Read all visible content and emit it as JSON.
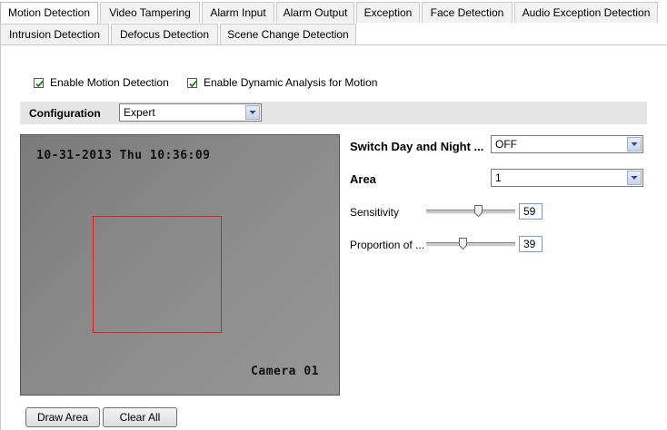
{
  "tabs_row1": [
    "Motion Detection",
    "Video Tampering",
    "Alarm Input",
    "Alarm Output",
    "Exception",
    "Face Detection",
    "Audio Exception Detection"
  ],
  "tabs_row2": [
    "Intrusion Detection",
    "Defocus Detection",
    "Scene Change Detection"
  ],
  "active_tab": "Motion Detection",
  "checkboxes": {
    "enable_motion": {
      "label": "Enable Motion Detection",
      "checked": true
    },
    "enable_dynamic": {
      "label": "Enable Dynamic Analysis for Motion",
      "checked": true
    }
  },
  "config": {
    "label": "Configuration",
    "value": "Expert"
  },
  "video": {
    "timestamp": "10-31-2013 Thu 10:36:09",
    "camera": "Camera 01"
  },
  "right": {
    "switch_label": "Switch Day and Night ...",
    "switch_value": "OFF",
    "area_label": "Area",
    "area_value": "1",
    "sensitivity_label": "Sensitivity",
    "sensitivity_value": "59",
    "proportion_label": "Proportion of ...",
    "proportion_value": "39"
  },
  "buttons": {
    "draw_area": "Draw Area",
    "clear_all": "Clear All"
  },
  "colors": {
    "accent_rect": "#e02020",
    "tab_border": "#c9c9c9",
    "config_bar": "#e5e5e5"
  }
}
